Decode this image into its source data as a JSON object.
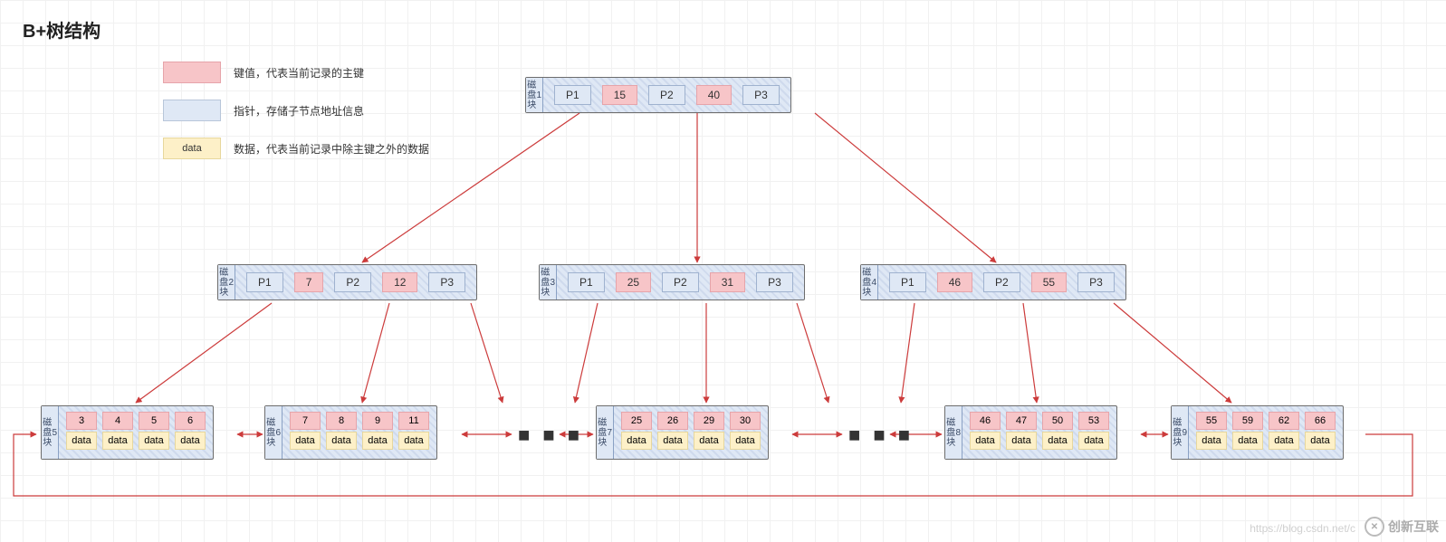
{
  "title": "B+树结构",
  "legend": {
    "key": "键值，代表当前记录的主键",
    "ptr": "指针，存储子节点地址信息",
    "data_label": "data",
    "data": "数据，代表当前记录中除主键之外的数据"
  },
  "block_label_prefix": "磁盘块",
  "nodes": {
    "n1": {
      "num": "1",
      "cells": [
        "P1",
        "15",
        "P2",
        "40",
        "P3"
      ]
    },
    "n2": {
      "num": "2",
      "cells": [
        "P1",
        "7",
        "P2",
        "12",
        "P3"
      ]
    },
    "n3": {
      "num": "3",
      "cells": [
        "P1",
        "25",
        "P2",
        "31",
        "P3"
      ]
    },
    "n4": {
      "num": "4",
      "cells": [
        "P1",
        "46",
        "P2",
        "55",
        "P3"
      ]
    },
    "n5": {
      "num": "5",
      "keys": [
        "3",
        "4",
        "5",
        "6"
      ],
      "data": [
        "data",
        "data",
        "data",
        "data"
      ]
    },
    "n6": {
      "num": "6",
      "keys": [
        "7",
        "8",
        "9",
        "11"
      ],
      "data": [
        "data",
        "data",
        "data",
        "data"
      ]
    },
    "n7": {
      "num": "7",
      "keys": [
        "25",
        "26",
        "29",
        "30"
      ],
      "data": [
        "data",
        "data",
        "data",
        "data"
      ]
    },
    "n8": {
      "num": "8",
      "keys": [
        "46",
        "47",
        "50",
        "53"
      ],
      "data": [
        "data",
        "data",
        "data",
        "data"
      ]
    },
    "n9": {
      "num": "9",
      "keys": [
        "55",
        "59",
        "62",
        "66"
      ],
      "data": [
        "data",
        "data",
        "data",
        "data"
      ]
    }
  },
  "ellipsis": "■ ■ ■",
  "watermark": {
    "url": "https://blog.csdn.net/c",
    "brand": "创新互联"
  }
}
